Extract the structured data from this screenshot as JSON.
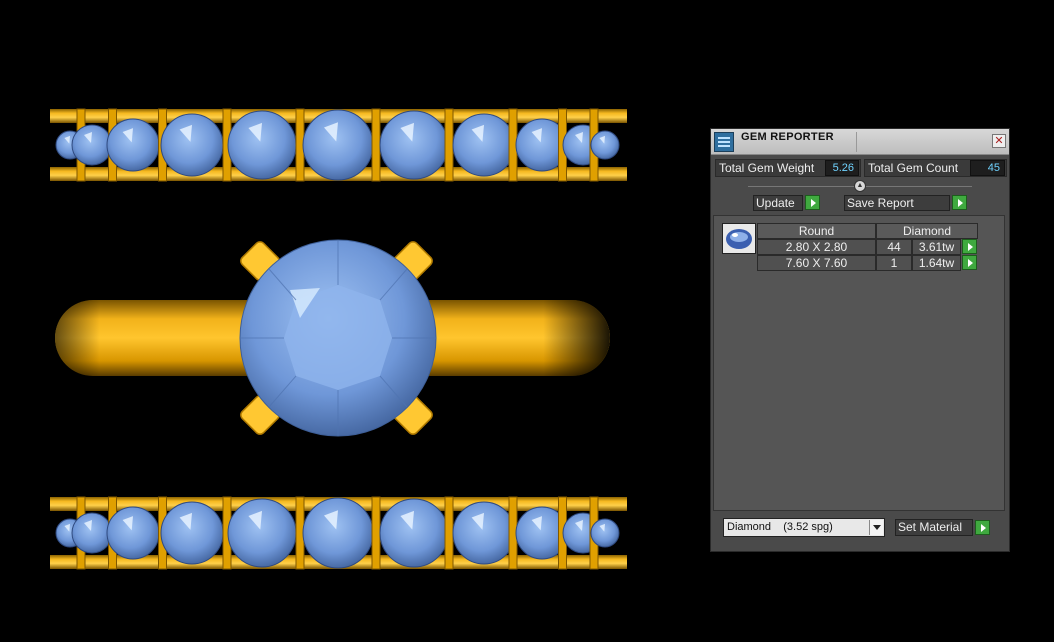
{
  "panel": {
    "title": "GEM REPORTER",
    "close_glyph": "✕",
    "total_weight_label": "Total Gem Weight",
    "total_weight_value": "5.26",
    "total_count_label": "Total Gem Count",
    "total_count_value": "45",
    "update_label": "Update",
    "save_report_label": "Save Report",
    "table": {
      "shape_header": "Round",
      "material_header": "Diamond",
      "rows": [
        {
          "size": "2.80 X 2.80",
          "count": "44",
          "weight": "3.61tw"
        },
        {
          "size": "7.60 X 7.60",
          "count": "1",
          "weight": "1.64tw"
        }
      ]
    },
    "material_select_value": "Diamond    (3.52 spg)",
    "set_material_label": "Set Material"
  },
  "colors": {
    "gold": "#f2b21a",
    "gem_blue": "#6f97d8",
    "accent_green": "#3fa93f",
    "value_cyan": "#6fd3ff"
  },
  "icons": {
    "app": "gem-reporter-app-icon",
    "close": "close-icon",
    "arrow": "green-play-arrow-icon",
    "thumb": "round-gem-thumbnail-icon",
    "dropdown": "chevron-down-icon"
  }
}
